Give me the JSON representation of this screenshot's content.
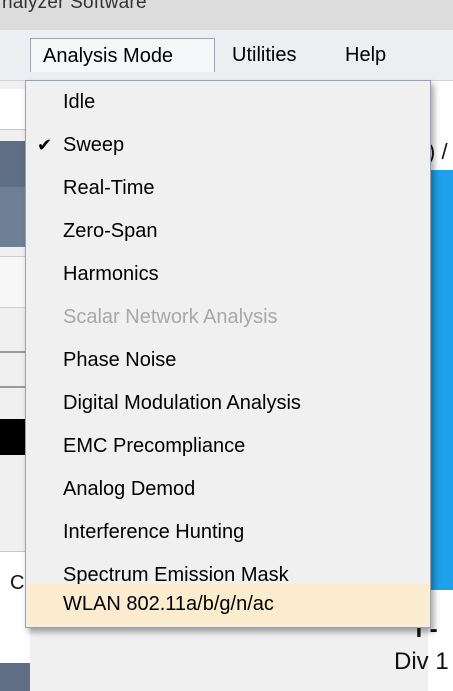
{
  "window": {
    "title": "nalyzer Software"
  },
  "menubar": {
    "items": [
      {
        "label": "Analysis Mode",
        "active": true
      },
      {
        "label": "Utilities"
      },
      {
        "label": "Help"
      }
    ]
  },
  "dropdown": {
    "items": [
      {
        "label": "Idle",
        "checked": false,
        "enabled": true
      },
      {
        "label": "Sweep",
        "checked": true,
        "enabled": true
      },
      {
        "label": "Real-Time",
        "checked": false,
        "enabled": true
      },
      {
        "label": "Zero-Span",
        "checked": false,
        "enabled": true
      },
      {
        "label": "Harmonics",
        "checked": false,
        "enabled": true
      },
      {
        "label": "Scalar Network Analysis",
        "checked": false,
        "enabled": false
      },
      {
        "label": "Phase Noise",
        "checked": false,
        "enabled": true
      },
      {
        "label": "Digital Modulation Analysis",
        "checked": false,
        "enabled": true
      },
      {
        "label": "EMC Precompliance",
        "checked": false,
        "enabled": true
      },
      {
        "label": "Analog Demod",
        "checked": false,
        "enabled": true
      },
      {
        "label": "Interference Hunting",
        "checked": false,
        "enabled": true
      },
      {
        "label": "Spectrum Emission Mask",
        "checked": false,
        "enabled": true
      },
      {
        "label": "WLAN 802.11a/b/g/n/ac",
        "checked": false,
        "enabled": true,
        "hovered": true
      }
    ],
    "check_glyph": "✔"
  },
  "background": {
    "right_top_fragment": ") /",
    "right_bottom_fragment_1": "f -",
    "right_bottom_fragment_2": "Div 1",
    "left_fragment": "C"
  },
  "colors": {
    "menu_bg": "#f0f0f0",
    "hover_bg": "#fbeccf",
    "disabled_text": "#a8a8a8",
    "accent_blue": "#1ea0ea"
  }
}
